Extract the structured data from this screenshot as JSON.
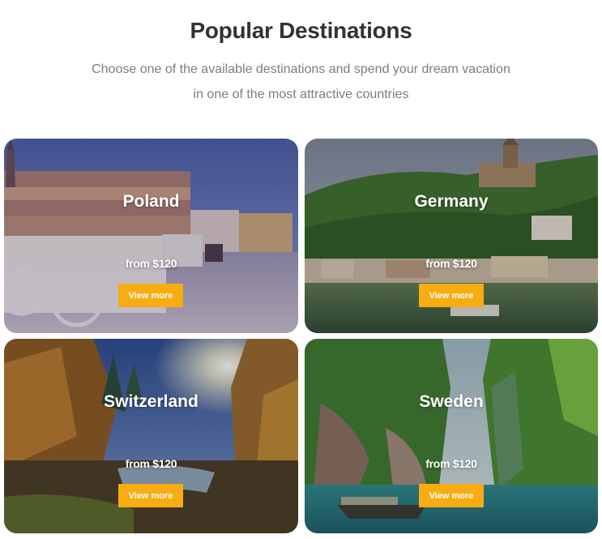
{
  "header": {
    "title": "Popular Destinations",
    "subtitle_line1": "Choose one of the available destinations and spend your dream vacation",
    "subtitle_line2": "in one of the most attractive countries"
  },
  "colors": {
    "accent": "#f7ac12",
    "title": "#2f3338",
    "subtitle": "#7a7d82"
  },
  "destinations": [
    {
      "name": "Poland",
      "price": "from $120",
      "button": "View more",
      "image": "old-town-square-with-horse-carriages"
    },
    {
      "name": "Germany",
      "price": "from $120",
      "button": "View more",
      "image": "river-town-with-hilltop-castle"
    },
    {
      "name": "Switzerland",
      "price": "from $120",
      "button": "View more",
      "image": "autumn-forest-river-with-sun"
    },
    {
      "name": "Sweden",
      "price": "from $120",
      "button": "View more",
      "image": "green-cliffs-with-boat-on-turquoise-water"
    }
  ]
}
